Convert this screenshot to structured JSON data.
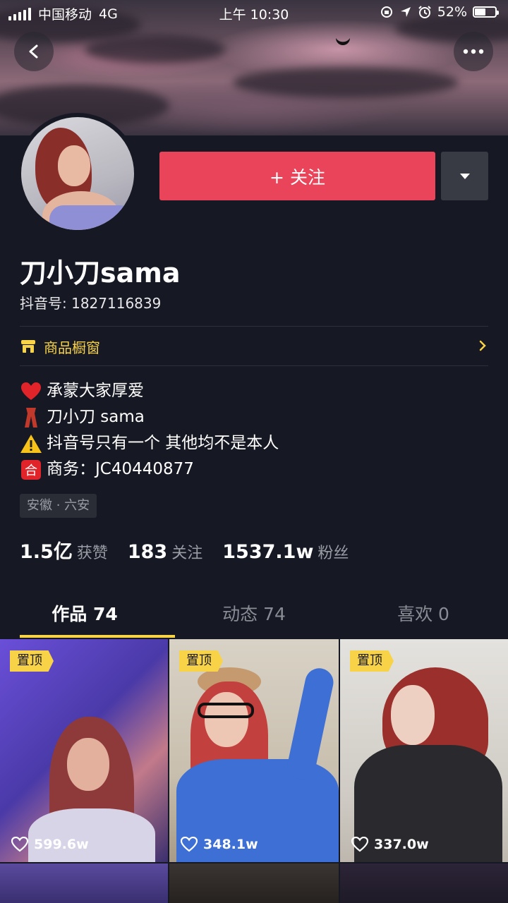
{
  "status_bar": {
    "carrier": "中国移动",
    "network": "4G",
    "time": "上午 10:30",
    "battery": "52%",
    "battery_level": 0.52
  },
  "header": {
    "back_icon": "back-arrow-icon",
    "more_icon": "more-dots-icon"
  },
  "profile": {
    "name": "刀小刀sama",
    "douyin_id": "抖音号: 1827116839",
    "follow_label": "+ 关注",
    "shop_label": "商品橱窗",
    "bio": [
      {
        "icon": "heart-emoji",
        "text": "承蒙大家厚爱"
      },
      {
        "icon": "scarf-emoji",
        "text": "刀小刀 sama"
      },
      {
        "icon": "warning-emoji",
        "text": "抖音号只有一个 其他均不是本人"
      },
      {
        "icon": "negotiate-emoji",
        "text": "商务：JC40440877"
      }
    ],
    "location": "安徽 · 六安"
  },
  "stats": [
    {
      "num": "1.5亿",
      "label": "获赞"
    },
    {
      "num": "183",
      "label": "关注"
    },
    {
      "num": "1537.1w",
      "label": "粉丝"
    }
  ],
  "tabs": [
    {
      "label": "作品 74",
      "active": true
    },
    {
      "label": "动态 74",
      "active": false
    },
    {
      "label": "喜欢 0",
      "active": false
    }
  ],
  "videos": [
    {
      "pin": "置顶",
      "likes": "599.6w"
    },
    {
      "pin": "置顶",
      "likes": "348.1w"
    },
    {
      "pin": "置顶",
      "likes": "337.0w"
    }
  ],
  "colors": {
    "background": "#161823",
    "follow_button": "#e9445a",
    "accent_yellow": "#f8d348",
    "muted_text": "#9a9ca5"
  }
}
